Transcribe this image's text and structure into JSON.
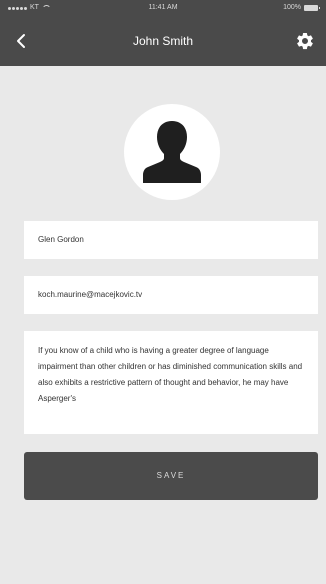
{
  "status_bar": {
    "carrier": "KT",
    "time": "11:41 AM",
    "battery": "100%"
  },
  "nav": {
    "title": "John Smith",
    "back_icon": "chevron-left-icon",
    "settings_icon": "gear-icon"
  },
  "profile": {
    "avatar_icon": "user-silhouette-icon",
    "name_value": "Glen Gordon",
    "email_value": "koch.maurine@macejkovic.tv",
    "bio_value": "If you know of a child who is having a greater degree of language impairment than other children or has diminished communication skills and also exhibits a restrictive pattern of thought and behavior, he may have Asperger's"
  },
  "actions": {
    "save_label": "SAVE"
  },
  "colors": {
    "header_bg": "#4a4a4a",
    "page_bg": "#e9e9e9",
    "button_bg": "#4b4b4b",
    "field_bg": "#ffffff"
  }
}
